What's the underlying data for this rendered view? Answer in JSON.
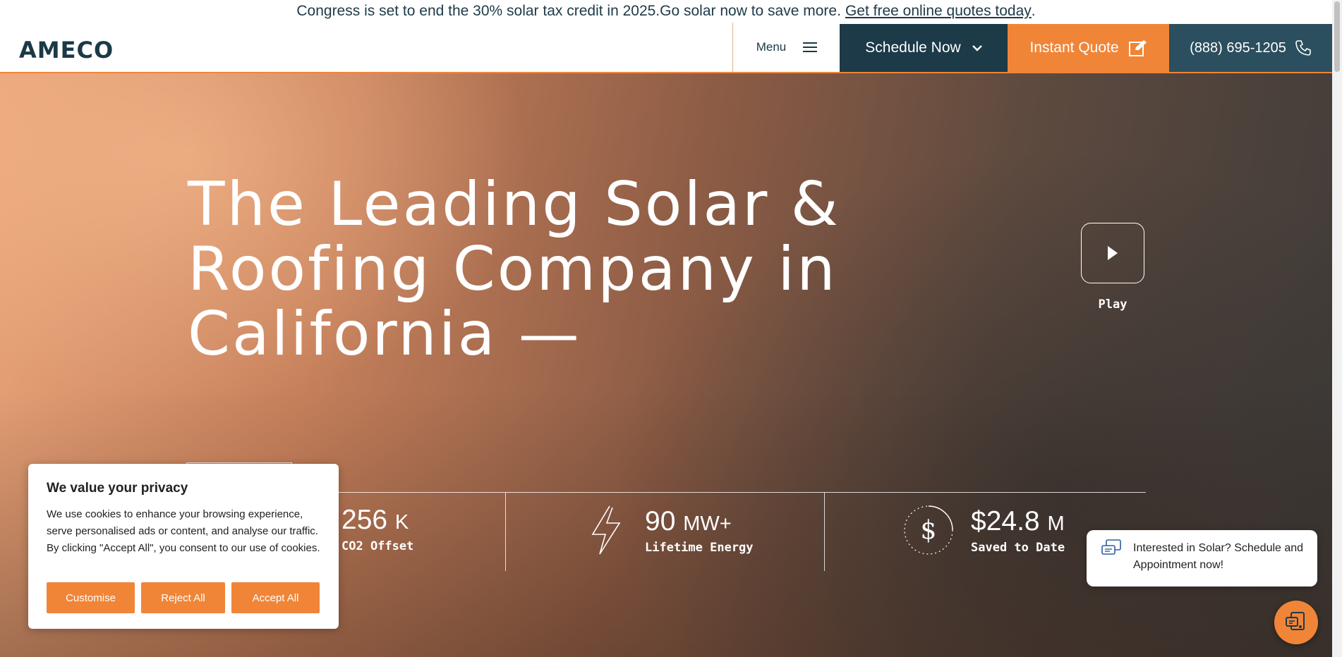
{
  "announcement": {
    "text": "Congress is set to end the 30% solar tax credit in 2025.Go solar now to save more.",
    "link": "Get free online quotes today",
    "suffix": "."
  },
  "header": {
    "logo": "AMECO",
    "menu_label": "Menu",
    "schedule_label": "Schedule Now",
    "quote_label": "Instant Quote",
    "phone": "(888) 695-1205"
  },
  "hero": {
    "headline": "The Leading Solar & Roofing Company in California —",
    "play_label": "Play"
  },
  "stats": [
    {
      "value": "256",
      "unit": "K",
      "label": "CO2 Offset",
      "icon": "leaf-icon"
    },
    {
      "value": "90",
      "unit": "MW+",
      "label": "Lifetime Energy",
      "icon": "lightning-icon"
    },
    {
      "value": "$24.8",
      "unit": "M",
      "label": "Saved to Date",
      "icon": "dollar-icon"
    }
  ],
  "cookie": {
    "title": "We value your privacy",
    "body": "We use cookies to enhance your browsing experience, serve personalised ads or content, and analyse our traffic. By clicking \"Accept All\", you consent to our use of cookies.",
    "customise": "Customise",
    "reject": "Reject All",
    "accept": "Accept All"
  },
  "chat": {
    "message": "Interested in Solar? Schedule and Appointment now!"
  },
  "colors": {
    "brand_navy": "#1c3a47",
    "brand_orange": "#f08538",
    "phone_teal": "#2b4f5e"
  }
}
